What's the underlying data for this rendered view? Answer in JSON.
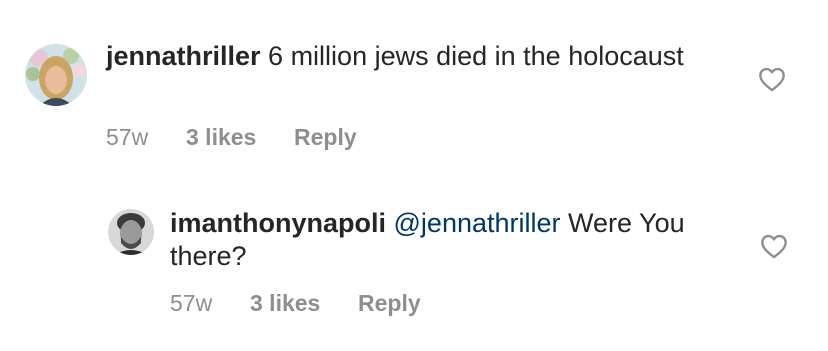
{
  "comments": [
    {
      "username": "jennathriller",
      "mention": "",
      "text": " 6 million jews died in the holocaust",
      "timestamp": "57w",
      "likes": "3 likes",
      "reply": "Reply"
    },
    {
      "username": "imanthonynapoli",
      "mention": "@jennathriller",
      "text": " Were You there?",
      "timestamp": "57w",
      "likes": "3 likes",
      "reply": "Reply"
    }
  ],
  "colors": {
    "text": "#262626",
    "meta": "#8e8e8e",
    "mention": "#00376b"
  },
  "icons": {
    "like": "heart-outline-icon"
  }
}
